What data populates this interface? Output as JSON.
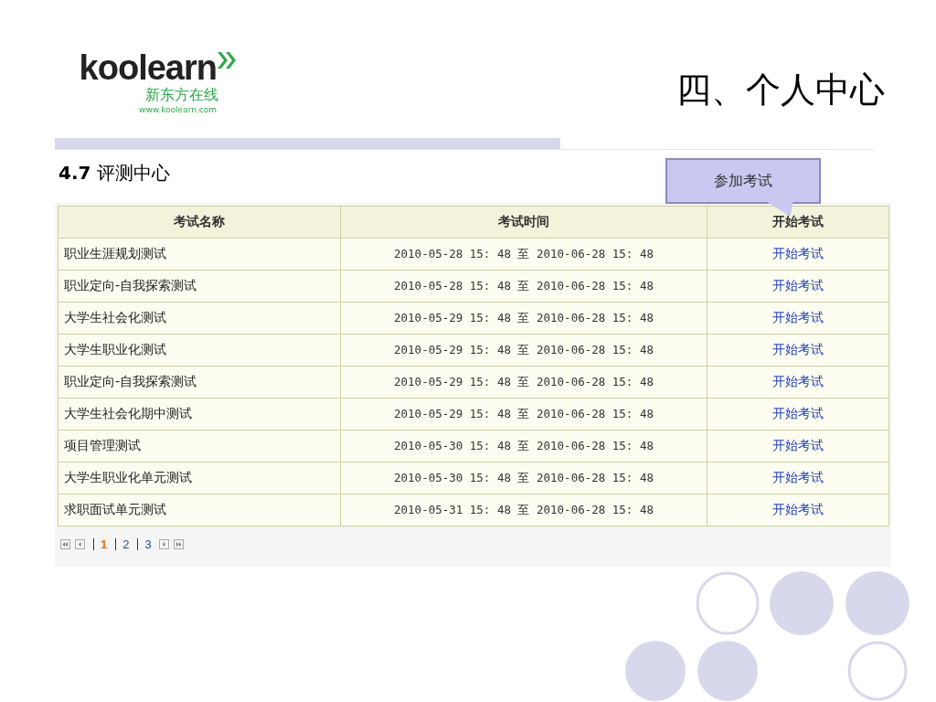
{
  "logo": {
    "wordmark": "koolearn",
    "chinese": "新东方在线",
    "url": "www.koolearn.com"
  },
  "slide_title": "四、个人中心",
  "section": {
    "number": "4.7",
    "title": "评测中心"
  },
  "callout": "参加考试",
  "table": {
    "columns": [
      "考试名称",
      "考试时间",
      "开始考试"
    ],
    "rows": [
      {
        "name": "职业生涯规划测试",
        "time": "2010-05-28 15: 48 至 2010-06-28 15: 48",
        "action": "开始考试"
      },
      {
        "name": "职业定向-自我探索测试",
        "time": "2010-05-28 15: 48 至 2010-06-28 15: 48",
        "action": "开始考试"
      },
      {
        "name": "大学生社会化测试",
        "time": "2010-05-29 15: 48 至 2010-06-28 15: 48",
        "action": "开始考试"
      },
      {
        "name": "大学生职业化测试",
        "time": "2010-05-29 15: 48 至 2010-06-28 15: 48",
        "action": "开始考试"
      },
      {
        "name": "职业定向-自我探索测试",
        "time": "2010-05-29 15: 48 至 2010-06-28 15: 48",
        "action": "开始考试"
      },
      {
        "name": "大学生社会化期中测试",
        "time": "2010-05-29 15: 48 至 2010-06-28 15: 48",
        "action": "开始考试"
      },
      {
        "name": "项目管理测试",
        "time": "2010-05-30 15: 48 至 2010-06-28 15: 48",
        "action": "开始考试"
      },
      {
        "name": "大学生职业化单元测试",
        "time": "2010-05-30 15: 48 至 2010-06-28 15: 48",
        "action": "开始考试"
      },
      {
        "name": "求职面试单元测试",
        "time": "2010-05-31 15: 48 至 2010-06-28 15: 48",
        "action": "开始考试"
      }
    ]
  },
  "pagination": {
    "pages": [
      {
        "label": "1",
        "selected": true
      },
      {
        "label": "2",
        "selected": false
      },
      {
        "label": "3",
        "selected": false
      }
    ]
  }
}
